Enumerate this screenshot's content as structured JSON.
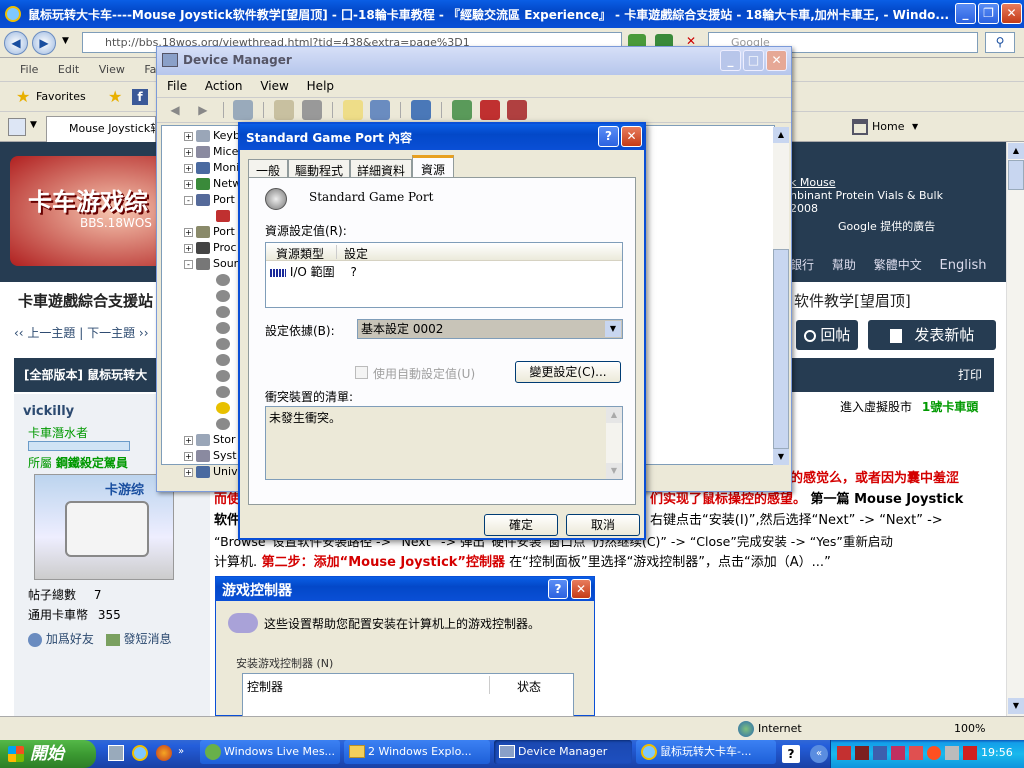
{
  "ie": {
    "title": "鼠标玩转大卡车----Mouse Joystick软件教学[望眉顶] - 囗-18輪卡車教程 - 『經驗交流區 Experience』 - 卡車遊戲綜合支援站 - 18輪大卡車,加州卡車王, - Windo...",
    "address": "http://bbs.18wos.org/viewthread.html?tid=438&extra=page%3D1",
    "search_placeholder": "Google",
    "menu": [
      "File",
      "Edit",
      "View",
      "Favor"
    ],
    "favorites": "Favorites",
    "tab_label": "Mouse Joystick软件",
    "home": "Home",
    "status_zone": "Internet",
    "zoom": "100%"
  },
  "forum": {
    "banner": "卡车游戏综",
    "banner_sub": "BBS.18WOS",
    "ad_link": "k Mouse",
    "ad_line1": "nbinant Protein Vials & Bulk",
    "ad_line2": "2008",
    "ad_google": "Google 提供的廣告",
    "nav_items": [
      "銀行",
      "幫助",
      "繁體中文",
      "English"
    ],
    "site_title": "卡車遊戲綜合支援站",
    "thread_title_right": "软件教学[望眉顶]",
    "prev": "‹‹ 上一主題",
    "next": "下一主題 ››",
    "reply_btn": "回帖",
    "post_btn": "发表新帖",
    "version_bar": "[全部版本] 鼠标玩转大",
    "print": "打印",
    "market": "進入虛擬股市",
    "first_truck": "1號卡車頭",
    "username": "vickilly",
    "rank": "卡車潛水者",
    "group_label": "所屬",
    "group_name": "鋼鐵殺定駕員",
    "avatar_text": "卡游综",
    "posts_label": "帖子總數",
    "posts_value": "7",
    "coins_label": "通用卡車幣",
    "coins_value": "355",
    "add_friend": "加爲好友",
    "send_pm": "發短消息",
    "line1_red": "的感觉么，或者因为囊中羞涩",
    "line2a": "而使",
    "line2b_red": "们实现了鼠标操控的感望。",
    "line2c": " 第一篇 Mouse Joystick",
    "line3a": "软件",
    "line3b": "右键点击“安装(I)”,然后选择“Next” -> “Next” ->",
    "line4": "“Browse”设置软件安装路径 -> “Next” -> 弹出“硬件安装”窗口点“仍然继续(C)” -> “Close”完成安装 -> “Yes”重新启动",
    "line5a": "计算机.",
    "line5b_red": " 第二步：添加“Mouse Joystick”控制器",
    "line5c": " 在“控制面板”里选择“游戏控制器”，点击“添加（A）...”"
  },
  "game_ctrl": {
    "title": "游戏控制器",
    "desc": "这些设置帮助您配置安装在计算机上的游戏控制器。",
    "group": "安装游戏控制器 (N)",
    "col_controller": "控制器",
    "col_status": "状态"
  },
  "devmgr": {
    "title": "Device Manager",
    "menu": [
      "File",
      "Action",
      "View",
      "Help"
    ],
    "tree": [
      {
        "label": "Keyb",
        "expand": "+"
      },
      {
        "label": "Mice",
        "expand": "+"
      },
      {
        "label": "Moni",
        "expand": "+"
      },
      {
        "label": "Netw",
        "expand": "+"
      },
      {
        "label": "Port",
        "expand": "-"
      },
      {
        "label": "",
        "expand": ""
      },
      {
        "label": "Port",
        "expand": "+"
      },
      {
        "label": "Proc",
        "expand": "+"
      },
      {
        "label": "Soun",
        "expand": "-"
      }
    ],
    "tree_bottom": [
      {
        "label": "Stor",
        "expand": "+"
      },
      {
        "label": "Syst",
        "expand": "+"
      },
      {
        "label": "Univ",
        "expand": "+"
      }
    ]
  },
  "props": {
    "title": "Standard Game Port 內容",
    "tabs": [
      "一般",
      "驅動程式",
      "詳細資料",
      "資源"
    ],
    "device_name": "Standard Game Port",
    "resource_settings": "資源設定值(R):",
    "col_type": "資源類型",
    "col_setting": "設定",
    "row_type": "I/O 範圍",
    "row_setting": "?",
    "setting_basis": "設定依據(B):",
    "basis_value": "基本設定 0002",
    "auto_settings": "使用自動設定值(U)",
    "change_btn": "變更設定(C)...",
    "conflict_label": "衝突裝置的清單:",
    "conflict_text": "未發生衝突。",
    "ok": "確定",
    "cancel": "取消"
  },
  "taskbar": {
    "start": "開始",
    "tasks": [
      "Windows Live Mes...",
      "2 Windows Explo...",
      "Device Manager",
      "鼠标玩转大卡车-..."
    ],
    "clock": "19:56"
  },
  "colors": {
    "xp_blue": "#0a5ee5",
    "forum_dark": "#2d3e50",
    "forum_red": "#d40000",
    "start_green": "#3c9a32"
  }
}
